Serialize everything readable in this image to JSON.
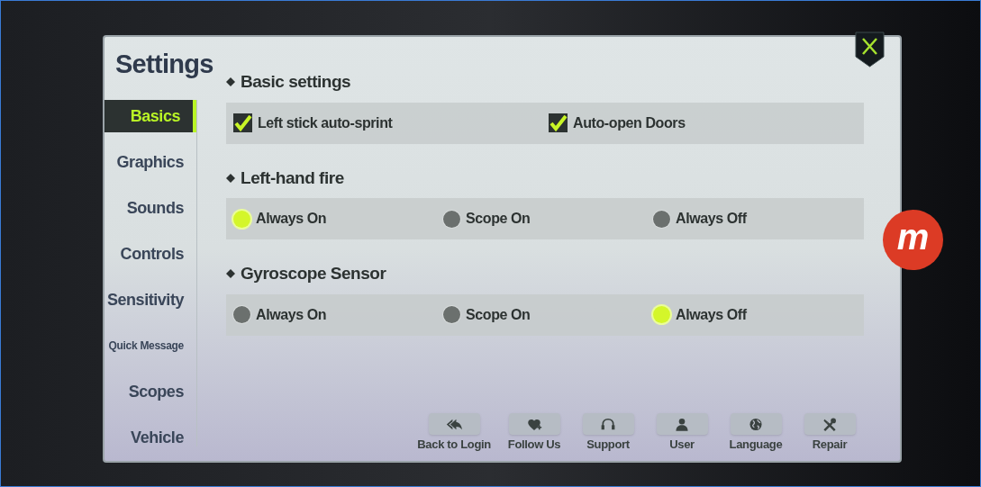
{
  "title": "Settings",
  "sidebar": {
    "items": [
      {
        "label": "Basics",
        "selected": true,
        "kind": "normal"
      },
      {
        "label": "Graphics",
        "selected": false,
        "kind": "normal"
      },
      {
        "label": "Sounds",
        "selected": false,
        "kind": "normal"
      },
      {
        "label": "Controls",
        "selected": false,
        "kind": "normal"
      },
      {
        "label": "Sensitivity",
        "selected": false,
        "kind": "normal"
      },
      {
        "label": "Quick Message",
        "selected": false,
        "kind": "small"
      },
      {
        "label": "Scopes",
        "selected": false,
        "kind": "normal"
      },
      {
        "label": "Vehicle",
        "selected": false,
        "kind": "normal"
      }
    ]
  },
  "sections": [
    {
      "heading": "Basic settings",
      "kind": "checkbox",
      "options": [
        {
          "label": "Left stick auto-sprint",
          "checked": true
        },
        {
          "label": "Auto-open Doors",
          "checked": true
        }
      ]
    },
    {
      "heading": "Left-hand fire",
      "kind": "radio",
      "options": [
        {
          "label": "Always On",
          "selected": true
        },
        {
          "label": "Scope On",
          "selected": false
        },
        {
          "label": "Always Off",
          "selected": false
        }
      ]
    },
    {
      "heading": "Gyroscope Sensor",
      "kind": "radio",
      "options": [
        {
          "label": "Always On",
          "selected": false
        },
        {
          "label": "Scope On",
          "selected": false
        },
        {
          "label": "Always Off",
          "selected": true
        }
      ]
    }
  ],
  "footer_buttons": [
    {
      "label": "Back to Login"
    },
    {
      "label": "Follow Us"
    },
    {
      "label": "Support"
    },
    {
      "label": "User"
    },
    {
      "label": "Language"
    },
    {
      "label": "Repair"
    }
  ],
  "overlay_button": {
    "label": "m"
  }
}
